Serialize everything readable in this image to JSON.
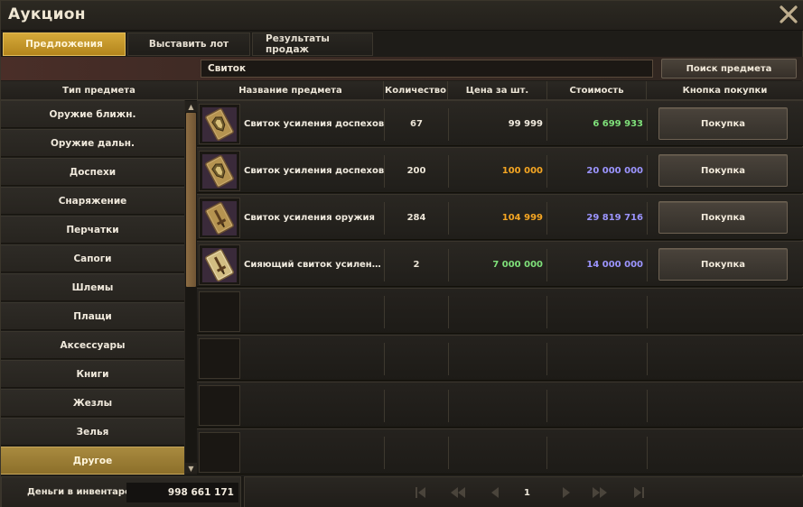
{
  "window": {
    "title": "Аукцион"
  },
  "icons": {
    "close": "close-icon",
    "scroll_up": "arrow-up-icon",
    "scroll_down": "arrow-down-icon"
  },
  "tabs": [
    {
      "label": "Предложения",
      "active": true
    },
    {
      "label": "Выставить лот",
      "active": false
    },
    {
      "label": "Результаты продаж",
      "active": false
    }
  ],
  "search": {
    "value": "Свиток",
    "button_label": "Поиск предмета"
  },
  "columns": {
    "type": "Тип предмета",
    "name": "Название предмета",
    "quantity": "Количество",
    "unit_price": "Цена за шт.",
    "cost": "Стоимость",
    "buy": "Кнопка покупки"
  },
  "categories": [
    {
      "label": "Оружие ближн.",
      "active": false
    },
    {
      "label": "Оружие дальн.",
      "active": false
    },
    {
      "label": "Доспехи",
      "active": false
    },
    {
      "label": "Снаряжение",
      "active": false
    },
    {
      "label": "Перчатки",
      "active": false
    },
    {
      "label": "Сапоги",
      "active": false
    },
    {
      "label": "Шлемы",
      "active": false
    },
    {
      "label": "Плащи",
      "active": false
    },
    {
      "label": "Аксессуары",
      "active": false
    },
    {
      "label": "Книги",
      "active": false
    },
    {
      "label": "Жезлы",
      "active": false
    },
    {
      "label": "Зелья",
      "active": false
    },
    {
      "label": "Другое",
      "active": true
    }
  ],
  "listings": [
    {
      "icon": "armor-scroll-icon",
      "name": "Свиток усиления доспехов",
      "quantity": "67",
      "unit_price": "99 999",
      "unit_price_color": "#f1ebdf",
      "cost": "6 699 933",
      "cost_color": "#7fe07a",
      "buy_label": "Покупка"
    },
    {
      "icon": "armor-scroll-icon",
      "name": "Свиток усиления доспехов",
      "quantity": "200",
      "unit_price": "100 000",
      "unit_price_color": "#f5a623",
      "cost": "20 000 000",
      "cost_color": "#9c95ff",
      "buy_label": "Покупка"
    },
    {
      "icon": "weapon-scroll-icon",
      "name": "Свиток усиления оружия",
      "quantity": "284",
      "unit_price": "104 999",
      "unit_price_color": "#f5a623",
      "cost": "29 819 716",
      "cost_color": "#9c95ff",
      "buy_label": "Покупка"
    },
    {
      "icon": "shining-scroll-icon",
      "name": "Сияющий свиток усилен…",
      "quantity": "2",
      "unit_price": "7 000 000",
      "unit_price_color": "#7fe07a",
      "cost": "14 000 000",
      "cost_color": "#9c95ff",
      "buy_label": "Покупка"
    }
  ],
  "footer": {
    "money_label": "Деньги в инвентаре",
    "money_value": "998 661 171",
    "page": "1"
  }
}
